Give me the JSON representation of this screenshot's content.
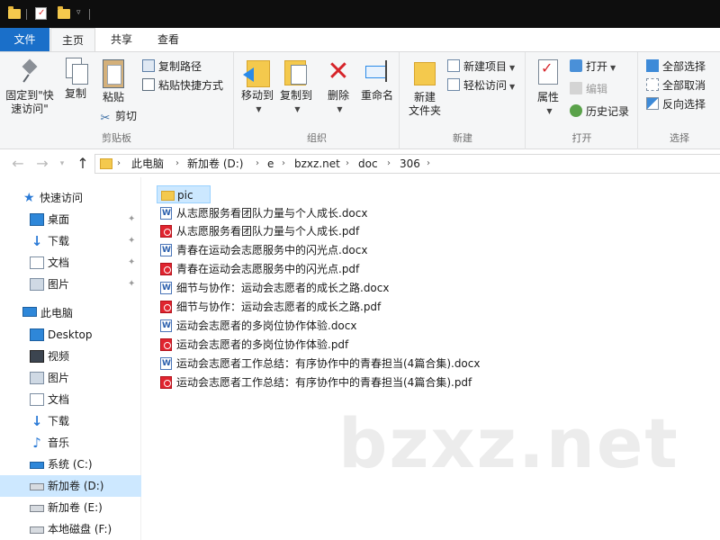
{
  "tabs": {
    "file": "文件",
    "home": "主页",
    "share": "共享",
    "view": "查看"
  },
  "ribbon": {
    "clipboard": {
      "label": "剪贴板",
      "pin_line1": "固定到\"快",
      "pin_line2": "速访问\"",
      "copy": "复制",
      "paste": "粘贴",
      "copy_path": "复制路径",
      "paste_shortcut": "粘贴快捷方式",
      "cut": "剪切"
    },
    "organize": {
      "label": "组织",
      "move_to": "移动到",
      "copy_to": "复制到",
      "delete": "删除",
      "rename": "重命名"
    },
    "new": {
      "label": "新建",
      "new_folder_line1": "新建",
      "new_folder_line2": "文件夹",
      "new_item": "新建项目",
      "easy_access": "轻松访问"
    },
    "open": {
      "label": "打开",
      "properties": "属性",
      "open": "打开",
      "edit": "编辑",
      "history": "历史记录"
    },
    "select": {
      "label": "选择",
      "select_all": "全部选择",
      "select_none": "全部取消",
      "invert": "反向选择"
    }
  },
  "address": {
    "crumbs": [
      "此电脑",
      "新加卷 (D:)",
      "e",
      "bzxz.net",
      "doc",
      "306"
    ]
  },
  "sidebar": {
    "quick_access": "快速访问",
    "quick_items": [
      "桌面",
      "下载",
      "文档",
      "图片"
    ],
    "this_pc": "此电脑",
    "pc_items": [
      "Desktop",
      "视频",
      "图片",
      "文档",
      "下载",
      "音乐",
      "系统 (C:)",
      "新加卷 (D:)",
      "新加卷 (E:)",
      "本地磁盘 (F:)"
    ]
  },
  "files": [
    {
      "name": "pic",
      "type": "folder"
    },
    {
      "name": "从志愿服务看团队力量与个人成长.docx",
      "type": "docx"
    },
    {
      "name": "从志愿服务看团队力量与个人成长.pdf",
      "type": "pdf"
    },
    {
      "name": "青春在运动会志愿服务中的闪光点.docx",
      "type": "docx"
    },
    {
      "name": "青春在运动会志愿服务中的闪光点.pdf",
      "type": "pdf"
    },
    {
      "name": "细节与协作：运动会志愿者的成长之路.docx",
      "type": "docx"
    },
    {
      "name": "细节与协作：运动会志愿者的成长之路.pdf",
      "type": "pdf"
    },
    {
      "name": "运动会志愿者的多岗位协作体验.docx",
      "type": "docx"
    },
    {
      "name": "运动会志愿者的多岗位协作体验.pdf",
      "type": "pdf"
    },
    {
      "name": "运动会志愿者工作总结：有序协作中的青春担当(4篇合集).docx",
      "type": "docx"
    },
    {
      "name": "运动会志愿者工作总结：有序协作中的青春担当(4篇合集).pdf",
      "type": "pdf"
    }
  ],
  "watermark": "bzxz.net",
  "colors": {
    "accent": "#1a6fc9",
    "selection": "#cde8ff",
    "folder": "#f4c94d",
    "pdf": "#e0242f",
    "titlebar": "#0e0e0e"
  }
}
